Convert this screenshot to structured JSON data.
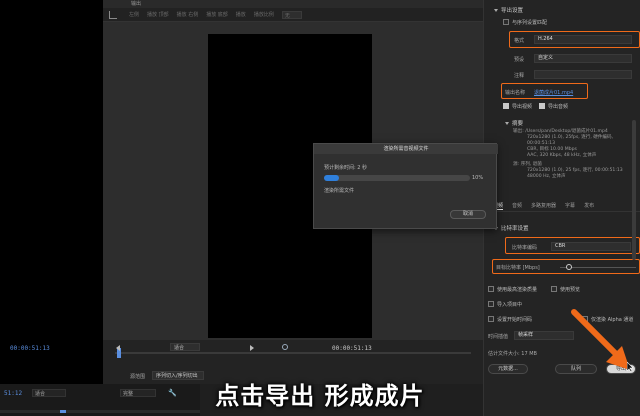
{
  "left": {
    "timecode": "",
    "bottom": {
      "timecode": "51:12",
      "fit": "适合",
      "full": "完整"
    }
  },
  "dialog": {
    "header_title": "输出",
    "source_tabs": [
      "左侧",
      "播放 顶部",
      "播放 右侧",
      "播放 底部",
      "播放",
      "播放比例"
    ],
    "source_select": "无",
    "preview": {
      "timecode_left": "00:00:51:13",
      "timecode_right": "00:00:51:13",
      "fit": "适合",
      "range_label": "源范围",
      "range_value": "序列切入/序列切出",
      "bottom_text": "正常"
    }
  },
  "settings": {
    "section_export": "导出设置",
    "match_sequence": "与序列设置匹配",
    "format_label": "格式",
    "format_value": "H.264",
    "preset_label": "预设",
    "preset_value": "自定义",
    "comment_label": "注释",
    "output_name_label": "输出名称",
    "output_name_value": "退菌成片01.mp4",
    "export_video": "导出视频",
    "export_audio": "导出音频",
    "summary_label": "摘要",
    "summary_output": "输出: /Users/pan/Desktop/退菌成片01.mp4",
    "summary_output_lines": [
      "720x1280 (1.0), 25fps, 逐行, 硬件编码, 00:00:51:13",
      "CBR, 目标 10.00 Mbps",
      "AAC, 320 Kbps, 48 kHz, 立体声"
    ],
    "summary_source": "源: 序列, 退菌",
    "summary_source_lines": [
      "720x1280 (1.0), 25 fps, 逐行, 00:00:51:13",
      "48000 Hz, 立体声"
    ],
    "tabs": [
      "视频",
      "音频",
      "多路复用器",
      "字幕",
      "发布"
    ],
    "bitrate_section": "比特率设置",
    "bitrate_encoding_label": "比特率编码",
    "bitrate_encoding_value": "CBR",
    "target_bitrate_label": "目标比特率 [Mbps]",
    "use_max_render": "使用最高渲染质量",
    "use_preview": "使用预览",
    "import_project": "导入项目中",
    "set_start_timecode": "设置开始时间码",
    "render_alpha": "仅渲染 Alpha 通道",
    "interp_label": "时间插值",
    "interp_value": "帧采样",
    "file_size_label": "估计文件大小: 17 MB",
    "metadata_button": "元数据...",
    "queue_button": "队列",
    "export_button": "导出"
  },
  "render_dialog": {
    "title": "渲染所需音视频文件",
    "remaining": "预计剩余时间: 2 秒",
    "progress": 0.1,
    "percent_text": "10%",
    "status": "渲染所需文件",
    "cancel": "取消"
  },
  "caption": "点击导出  形成成片",
  "colors": {
    "accent_blue": "#2f7fdb",
    "highlight_orange": "#f06a1a",
    "timecode_blue": "#5b8fe0"
  }
}
